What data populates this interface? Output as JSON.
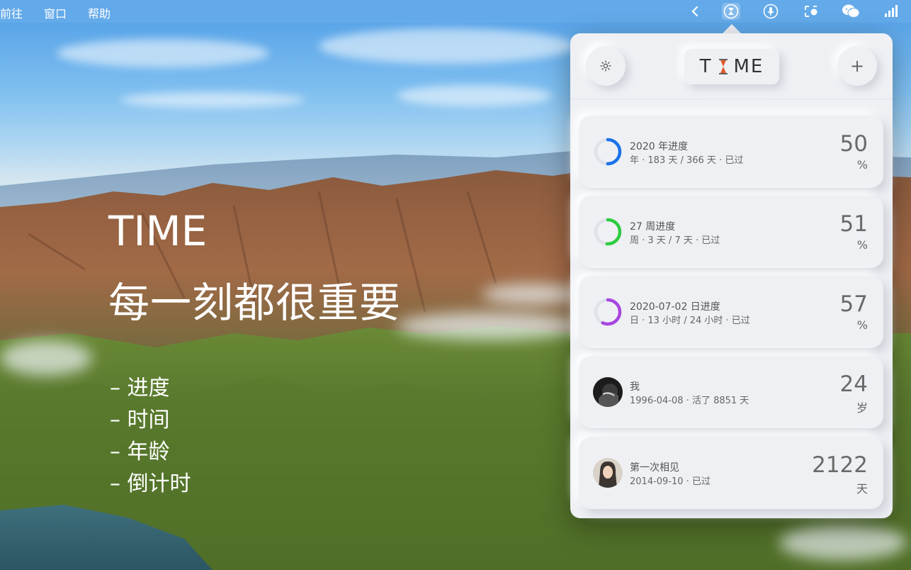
{
  "menubar": {
    "items": [
      "前往",
      "窗口",
      "帮助"
    ],
    "status_icons": [
      "chevron-left-icon",
      "time-hourglass-icon",
      "microphone-icon",
      "screen-capture-icon",
      "wechat-icon",
      "signal-bars-icon"
    ]
  },
  "promo": {
    "title": "TIME",
    "slogan": "每一刻都很重要",
    "features": [
      "– 进度",
      "– 时间",
      "– 年龄",
      "– 倒计时"
    ]
  },
  "app": {
    "logo_left": "T",
    "logo_right": "ME",
    "settings_icon": "gear-icon",
    "add_symbol": "+",
    "cards": [
      {
        "title": "2020 年进度",
        "subtitle": "年 · 183 天 / 366 天 · 已过",
        "value": "50",
        "unit": "%",
        "progress": 0.5,
        "color": "#1a73e8",
        "kind": "ring"
      },
      {
        "title": "27 周进度",
        "subtitle": "周 · 3 天 / 7 天 · 已过",
        "value": "51",
        "unit": "%",
        "progress": 0.51,
        "color": "#2ecc40",
        "kind": "ring"
      },
      {
        "title": "2020-07-02 日进度",
        "subtitle": "日 · 13 小时 / 24 小时 · 已过",
        "value": "57",
        "unit": "%",
        "progress": 0.57,
        "color": "#a846e0",
        "kind": "ring"
      },
      {
        "title": "我",
        "subtitle": "1996-04-08 · 活了 8851 天",
        "value": "24",
        "unit": "岁",
        "kind": "avatar-dark"
      },
      {
        "title": "第一次相见",
        "subtitle": "2014-09-10 · 已过",
        "value": "2122",
        "unit": "天",
        "kind": "avatar-light"
      }
    ]
  },
  "colors": {
    "accent": "#1a73e8",
    "panel": "#eef0f4",
    "hourglass": "#e05a2b"
  }
}
